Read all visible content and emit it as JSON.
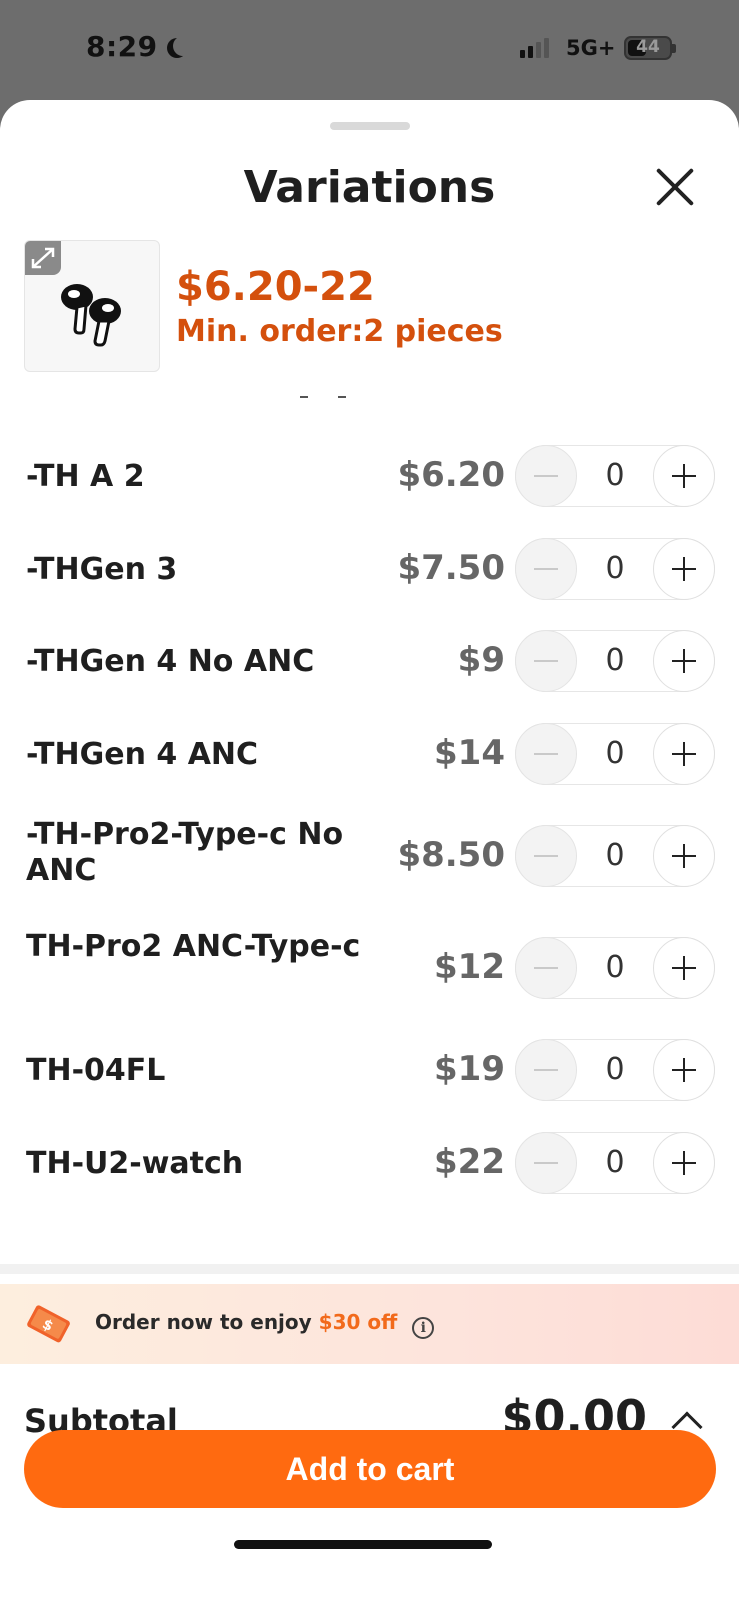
{
  "status_bar": {
    "time": "8:29",
    "network": "5G+",
    "battery": "44"
  },
  "sheet": {
    "title": "Variations",
    "price_range": "$6.20-22",
    "min_order": "Min. order:2 pieces"
  },
  "variations": [
    {
      "label": "-TH A 2",
      "price": "$6.20",
      "qty": "0"
    },
    {
      "label": "-THGen 3",
      "price": "$7.50",
      "qty": "0"
    },
    {
      "label": "-THGen 4 No ANC",
      "price": "$9",
      "qty": "0"
    },
    {
      "label": "-THGen 4 ANC",
      "price": "$14",
      "qty": "0"
    },
    {
      "label": "-TH-Pro2-Type-c No ANC",
      "price": "$8.50",
      "qty": "0"
    },
    {
      "label": "TH-Pro2 ANC-Type-c",
      "price": "$12",
      "qty": "0"
    },
    {
      "label": "TH-04FL",
      "price": "$19",
      "qty": "0"
    },
    {
      "label": "TH-U2-watch",
      "price": "$22",
      "qty": "0"
    }
  ],
  "promo": {
    "text_before": "Order now to enjoy",
    "text_accent": "$30 off"
  },
  "footer": {
    "subtotal_label": "Subtotal",
    "subtotal_value": "$0.00",
    "add_to_cart": "Add to cart"
  },
  "colors": {
    "accent_orange": "#ff6a10",
    "price_orange": "#d4500d",
    "sheet_bg": "#ffffff",
    "backdrop": "#6d6d6d"
  }
}
